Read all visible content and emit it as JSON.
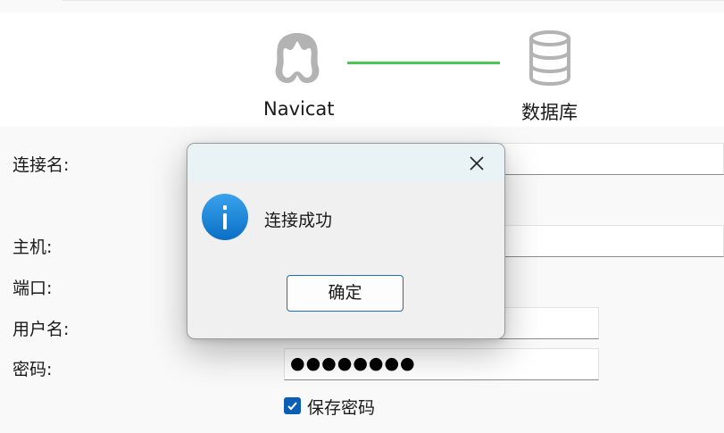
{
  "header": {
    "source_label": "Navicat",
    "target_label": "数据库",
    "source_icon": "navicat-logo-icon",
    "target_icon": "database-icon",
    "connector_color": "#4cc653"
  },
  "form": {
    "connection_name_label": "连接名:",
    "connection_name_value": "",
    "host_label": "主机:",
    "host_value": "",
    "port_label": "端口:",
    "username_label": "用户名:",
    "username_value": "",
    "password_label": "密码:",
    "password_mask": "●●●●●●●●",
    "save_password_label": "保存密码",
    "save_password_checked": true
  },
  "dialog": {
    "icon": "info-icon",
    "message": "连接成功",
    "ok_label": "确定",
    "close_icon": "close-icon",
    "accent_color": "#1c6fb0"
  }
}
